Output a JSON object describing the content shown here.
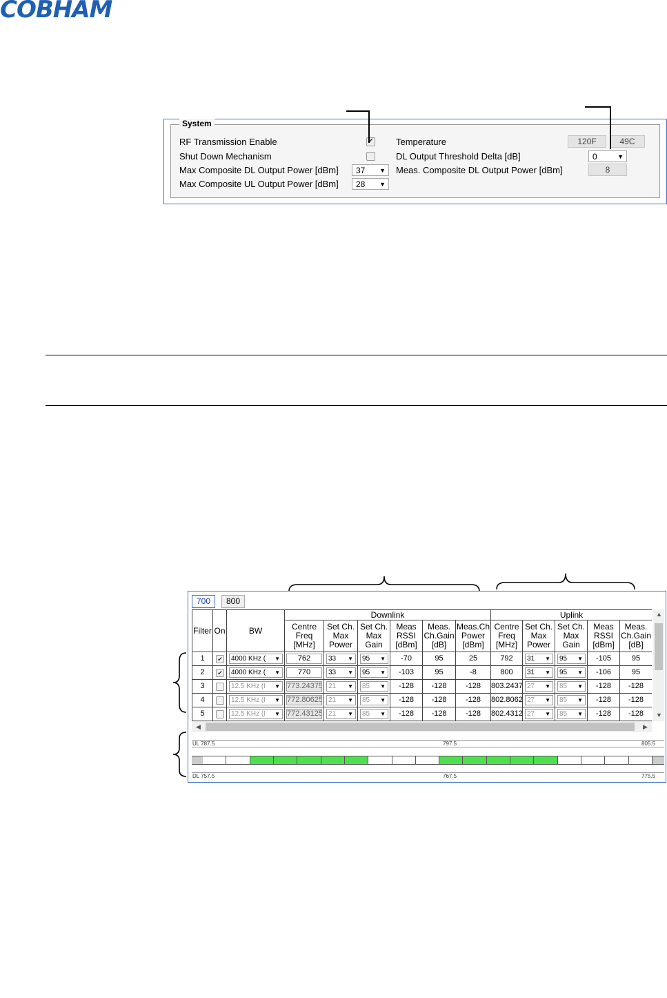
{
  "logo": "COBHAM",
  "system": {
    "legend": "System",
    "rf_enable": {
      "label": "RF Transmission Enable",
      "checked": true
    },
    "shutdown": {
      "label": "Shut Down Mechanism",
      "checked": false
    },
    "max_dl": {
      "label": "Max Composite DL Output Power [dBm]",
      "value": "37"
    },
    "max_ul": {
      "label": "Max Composite UL Output Power [dBm]",
      "value": "28"
    },
    "temperature": {
      "label": "Temperature",
      "f": "120F",
      "c": "49C"
    },
    "dl_threshold": {
      "label": "DL Output Threshold Delta [dB]",
      "value": "0"
    },
    "meas_dl": {
      "label": "Meas. Composite DL Output Power [dBm]",
      "value": "8"
    }
  },
  "filters": {
    "tabs": [
      "700",
      "800"
    ],
    "active_tab": "700",
    "group_downlink": "Downlink",
    "group_uplink": "Uplink",
    "headers": {
      "filter": "Filter",
      "on": "On",
      "bw": "BW",
      "dl_freq": "Centre Freq [MHz]",
      "dl_max_power": "Set Ch. Max Power",
      "dl_max_gain": "Set Ch. Max Gain",
      "dl_rssi": "Meas RSSI [dBm]",
      "dl_gain": "Meas. Ch.Gain [dB]",
      "dl_power": "Meas.Ch Power [dBm]",
      "ul_freq": "Centre Freq [MHz]",
      "ul_max_power": "Set Ch. Max Power",
      "ul_max_gain": "Set Ch. Max Gain",
      "ul_rssi": "Meas RSSI [dBm]",
      "ul_gain": "Meas. Ch.Gain [dB]"
    },
    "rows": [
      {
        "n": "1",
        "on": true,
        "bw": "4000 KHz (",
        "dl_freq": "762",
        "dl_pwr": "33",
        "dl_gain": "95",
        "dl_rssi": "-70",
        "dl_mgain": "95",
        "dl_mpwr": "25",
        "ul_freq": "792",
        "ul_pwr": "31",
        "ul_gain": "95",
        "ul_rssi": "-105",
        "ul_mgain": "95"
      },
      {
        "n": "2",
        "on": true,
        "bw": "4000 KHz (",
        "dl_freq": "770",
        "dl_pwr": "33",
        "dl_gain": "95",
        "dl_rssi": "-103",
        "dl_mgain": "95",
        "dl_mpwr": "-8",
        "ul_freq": "800",
        "ul_pwr": "31",
        "ul_gain": "95",
        "ul_rssi": "-106",
        "ul_mgain": "95"
      },
      {
        "n": "3",
        "on": false,
        "bw": "12.5 KHz (I",
        "dl_freq": "773.24375",
        "dl_pwr": "21",
        "dl_gain": "85",
        "dl_rssi": "-128",
        "dl_mgain": "-128",
        "dl_mpwr": "-128",
        "ul_freq": "803.2437!",
        "ul_pwr": "27",
        "ul_gain": "85",
        "ul_rssi": "-128",
        "ul_mgain": "-128"
      },
      {
        "n": "4",
        "on": false,
        "bw": "12.5 KHz (I",
        "dl_freq": "772.80625",
        "dl_pwr": "21",
        "dl_gain": "85",
        "dl_rssi": "-128",
        "dl_mgain": "-128",
        "dl_mpwr": "-128",
        "ul_freq": "802.8062!",
        "ul_pwr": "27",
        "ul_gain": "85",
        "ul_rssi": "-128",
        "ul_mgain": "-128"
      },
      {
        "n": "5",
        "on": false,
        "bw": "12.5 KHz (I",
        "dl_freq": "772.43125",
        "dl_pwr": "21",
        "dl_gain": "85",
        "dl_rssi": "-128",
        "dl_mgain": "-128",
        "dl_mpwr": "-128",
        "ul_freq": "802.4312!",
        "ul_pwr": "27",
        "ul_gain": "85",
        "ul_rssi": "-128",
        "ul_mgain": "-128"
      }
    ],
    "spectrum": {
      "ul_start": "UL 787.5",
      "ul_mid": "797.5",
      "ul_end": "805.5",
      "dl_start": "DL 757.5",
      "dl_mid": "767.5",
      "dl_end": "775.5",
      "segments": [
        false,
        false,
        true,
        true,
        true,
        true,
        true,
        false,
        false,
        false,
        true,
        true,
        true,
        true,
        true,
        false,
        false,
        false,
        false
      ]
    }
  },
  "colors": {
    "accent_border": "#3f6fc7",
    "active_segment": "#4fdf4f",
    "logo": "#1f5fb4"
  }
}
